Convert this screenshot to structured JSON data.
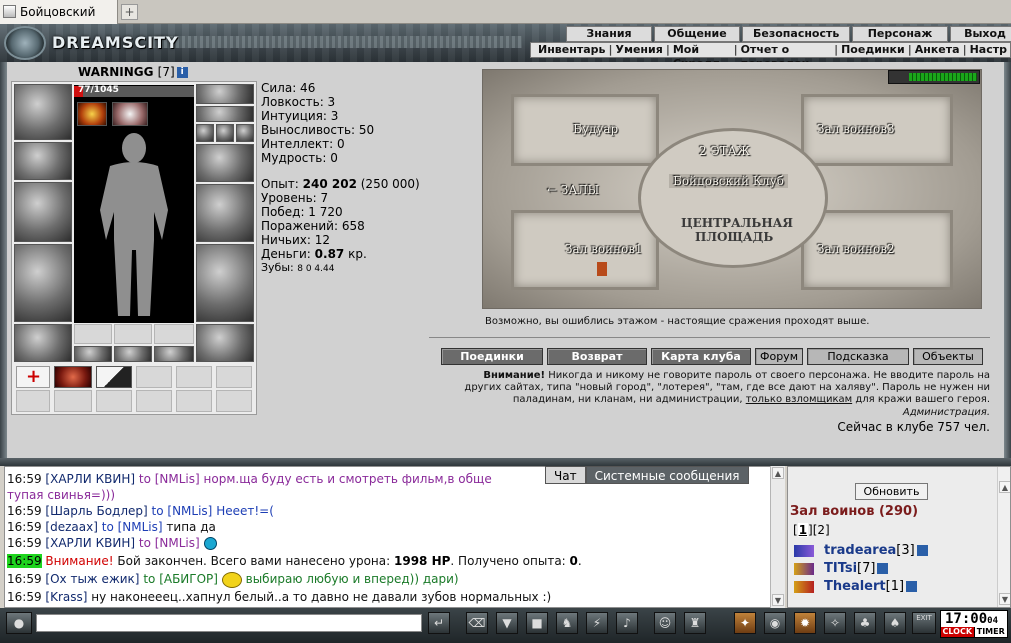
{
  "browser": {
    "tab_title": "Бойцовский клуб",
    "new_tab": "+"
  },
  "header": {
    "logo_text": "DREAMSCITY",
    "menu_top": [
      "Знания",
      "Общение",
      "Безопасность",
      "Персонаж",
      "Выход"
    ],
    "menu_sub": [
      "Инвентарь",
      "Умения",
      "Мой Скролл",
      "Отчет о переводах",
      "Поединки",
      "Анкета",
      "Настр"
    ]
  },
  "character": {
    "name": "WARNINGG",
    "level": "[7]",
    "hp_text": "77/1045",
    "hp_fraction": 0.074,
    "stats": [
      "Сила: 46",
      "Ловкость: 3",
      "Интуиция: 3",
      "Выносливость: 50",
      "Интеллект: 0",
      "Мудрость: 0"
    ],
    "exp_label": "Опыт:",
    "exp_value": "240 202",
    "exp_next": "(250 000)",
    "level_line": "Уровень: 7",
    "wins_line": "Побед: 1 720",
    "losses_line": "Поражений: 658",
    "draws_line": "Ничьих: 12",
    "money_label": "Деньги:",
    "money_value": "0.87",
    "money_unit": "кр.",
    "teeth_label": "Зубы:",
    "teeth_values": "8 0 4.44"
  },
  "map": {
    "rooms": [
      "Будуар",
      "Зал воинов3",
      "Зал воинов1",
      "Зал воинов2"
    ],
    "floor_label": "2 ЭТАЖ",
    "club_label": "Бойцовский Клуб",
    "halls_label": "ЗАЛЫ",
    "plaza_label_1": "ЦЕНТРАЛЬНАЯ",
    "plaza_label_2": "ПЛОЩАДЬ",
    "energy_fraction": 0.95
  },
  "notice": {
    "wrong_floor": "Возможно, вы ошиблись этажом - настоящие сражения проходят выше.",
    "buttons": [
      "Поединки",
      "Возврат",
      "Карта клуба",
      "Форум",
      "Подсказка",
      "Объекты"
    ],
    "warning_bold": "Внимание!",
    "warning_text_1": " Никогда и никому не говорите пароль от своего персонажа. Не вводите пароль на",
    "warning_text_2": "других сайтах, типа \"новый город\", \"лотерея\", \"там, где все дают на халяву\". Пароль не нужен ни",
    "warning_text_3a": "паладинам, ни кланам, ни администрации, ",
    "warning_link": "только взломщикам",
    "warning_text_3b": " для кражи вашего героя.",
    "admin": "Администрация.",
    "online": "Сейчас в клубе 757 чел."
  },
  "chat": {
    "tabs": [
      "Чат",
      "Системные сообщения"
    ],
    "lines": [
      {
        "time": "16:59",
        "nick": "[ХАРЛИ КВИН]",
        "to": "to",
        "target": "[NMLis]",
        "text": "норм.ща буду есть и смотреть фильм,в обще"
      },
      {
        "time": "",
        "nick": "",
        "to": "",
        "target": "",
        "text": "тупая свинья=)))"
      },
      {
        "time": "16:59",
        "nick": "[Шарль Бодлер]",
        "to": "to",
        "target": "[NMLis]",
        "text": "Нееет!=("
      },
      {
        "time": "16:59",
        "nick": "[dezaax]",
        "to": "to",
        "target": "[NMLis]",
        "text": "типа да"
      },
      {
        "time": "16:59",
        "nick": "[ХАРЛИ КВИН]",
        "to": "to",
        "target": "[NMLis]",
        "text": ""
      },
      {
        "time": "16:59",
        "sys_bold": "Внимание!",
        "text": "Бой закончен. Всего вами нанесено урона:",
        "dmg": "1998 HP",
        "text2": ". Получено опыта:",
        "exp": "0",
        "text3": "."
      },
      {
        "time": "16:59",
        "nick": "[Ох тыж ежик]",
        "to": "to",
        "target": "[АБИГОР]",
        "text": "выбираю любую и вперед)) дари)"
      },
      {
        "time": "16:59",
        "nick": "[Krass]",
        "to": "",
        "target": "",
        "text": "ну наконееец..хапнул белый..а то давно не давали зубов нормальных :)"
      }
    ]
  },
  "room_panel": {
    "refresh": "Обновить",
    "title": "Зал воинов (290)",
    "page1": "1",
    "page2": "[2]",
    "players": [
      {
        "name": "tradearea",
        "level": "[3]"
      },
      {
        "name": "TITsi",
        "level": "[7]"
      },
      {
        "name": "Thealert",
        "level": "[1]"
      }
    ]
  },
  "toolbar": {
    "clock_time": "17:00",
    "clock_sec": "04",
    "clock_label": "CLOCK",
    "timer_label": "TIMER",
    "exit_label": "EXIT"
  }
}
